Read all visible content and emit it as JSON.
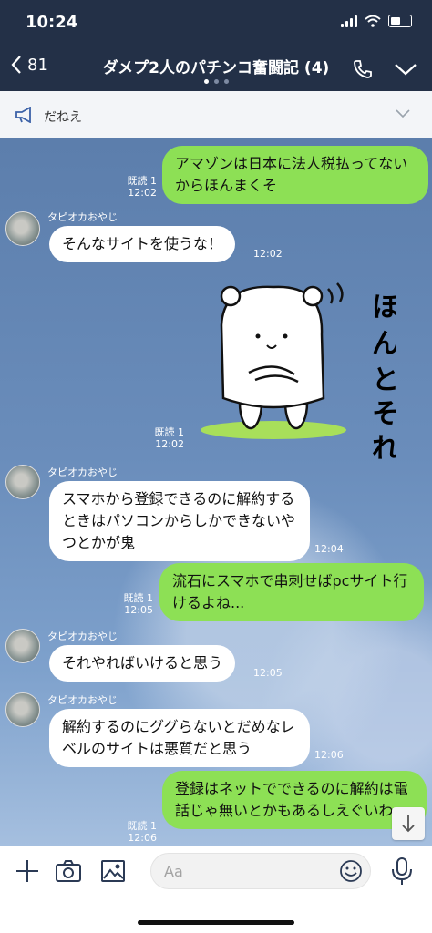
{
  "status": {
    "time": "10:24"
  },
  "header": {
    "back_count": "81",
    "title": "ダメプ2人のパチンコ奮闘記 (4)"
  },
  "notice": {
    "text": "だねえ"
  },
  "messages": [
    {
      "side": "out",
      "text": "アマゾンは日本に法人税払ってないからほんまくそ",
      "read": "既読 1",
      "time": "12:02"
    },
    {
      "side": "in",
      "sender": "タピオカおやじ",
      "text": "そんなサイトを使うな！",
      "time": "12:02"
    },
    {
      "side": "out",
      "type": "sticker",
      "sticker_text": "ほんとそれ",
      "read": "既読 1",
      "time": "12:02"
    },
    {
      "side": "in",
      "sender": "タピオカおやじ",
      "text": "スマホから登録できるのに解約するときはパソコンからしかできないやつとかが鬼",
      "time": "12:04"
    },
    {
      "side": "out",
      "text": "流石にスマホで串刺せばpcサイト行けるよね...",
      "read": "既読 1",
      "time": "12:05"
    },
    {
      "side": "in",
      "sender": "タピオカおやじ",
      "text": "それやればいけると思う",
      "time": "12:05"
    },
    {
      "side": "in",
      "sender": "タピオカおやじ",
      "text": "解約するのにググらないとだめなレベルのサイトは悪質だと思う",
      "time": "12:06"
    },
    {
      "side": "out",
      "text": "登録はネットでできるのに解約は電話じゃ無いとかもあるしえぐいわ",
      "read": "既読 1",
      "time": "12:06"
    }
  ],
  "composer": {
    "placeholder": "Aa"
  },
  "colors": {
    "header_bg": "#233047",
    "outgoing_bubble": "#8de055",
    "incoming_bubble": "#ffffff"
  }
}
